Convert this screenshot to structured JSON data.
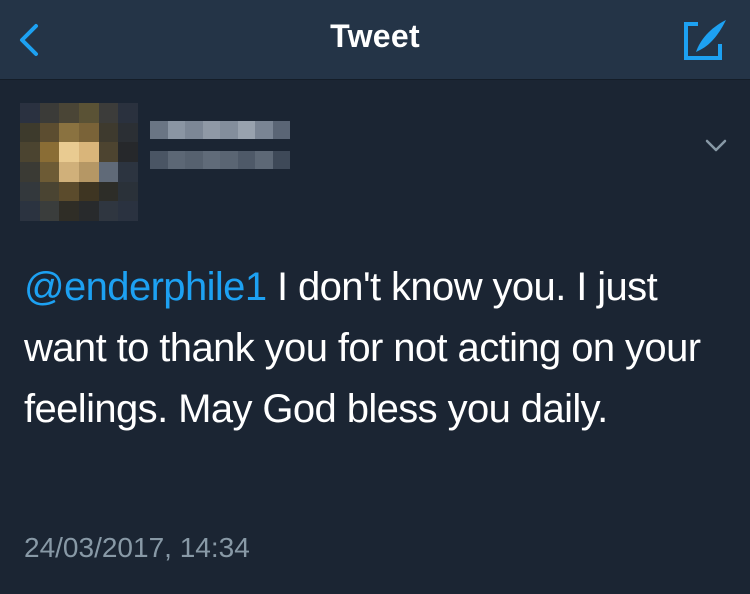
{
  "nav": {
    "title": "Tweet",
    "back_icon": "chevron-left-icon",
    "compose_icon": "compose-tweet-icon"
  },
  "tweet": {
    "mention": "@enderphile1",
    "body": " I don't know you. I just want to thank you for not acting on your feelings. May God bless you daily.",
    "timestamp": "24/03/2017, 14:34",
    "menu_icon": "chevron-down-icon"
  },
  "colors": {
    "nav_background": "#243447",
    "content_background": "#1b2533",
    "accent": "#1da1f2",
    "secondary_text": "#8899a6"
  }
}
